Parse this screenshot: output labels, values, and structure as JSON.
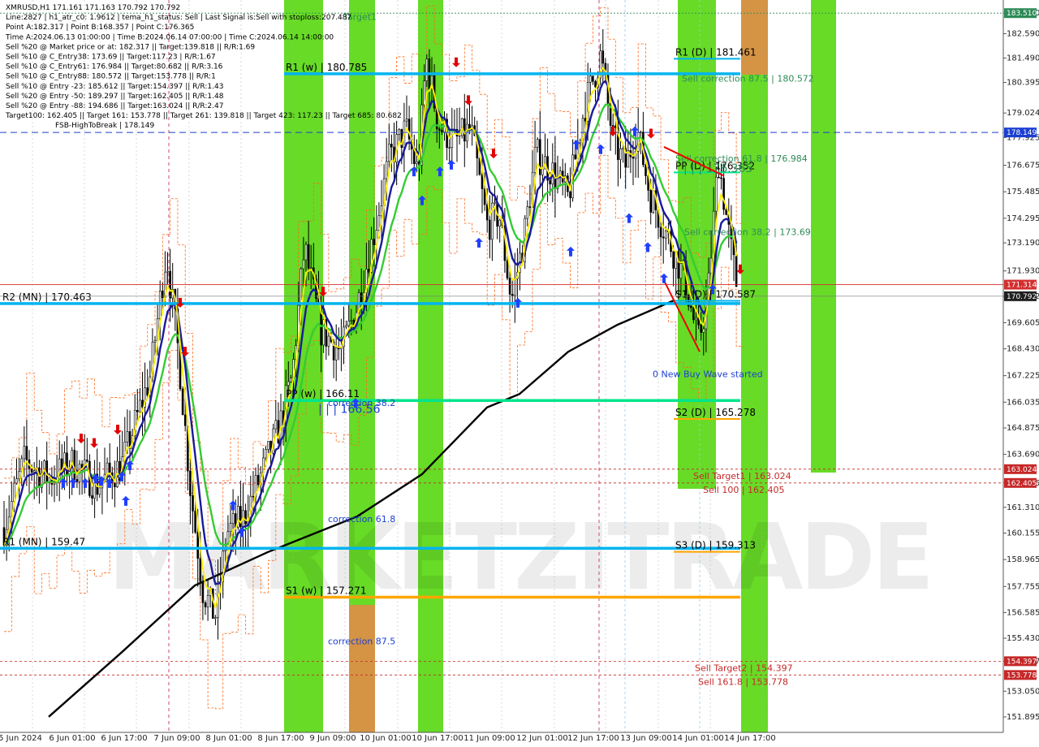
{
  "chart_data": {
    "type": "candlestick",
    "symbol": "XMRUSD,H1",
    "ylim": [
      151.2,
      184.1
    ],
    "x_ticks": [
      "5 Jun 2024",
      "6 Jun 01:00",
      "6 Jun 17:00",
      "7 Jun 09:00",
      "8 Jun 01:00",
      "8 Jun 17:00",
      "9 Jun 09:00",
      "10 Jun 01:00",
      "10 Jun 17:00",
      "11 Jun 09:00",
      "12 Jun 01:00",
      "12 Jun 17:00",
      "13 Jun 09:00",
      "14 Jun 01:00",
      "14 Jun 17:00"
    ],
    "y_ticks": [
      "183.510",
      "182.590",
      "181.490",
      "180.395",
      "179.024",
      "177.925",
      "176.675",
      "175.485",
      "174.295",
      "173.190",
      "171.930",
      "170.792",
      "169.605",
      "168.430",
      "167.225",
      "166.035",
      "164.875",
      "163.690",
      "162.405",
      "161.310",
      "160.155",
      "158.965",
      "157.755",
      "156.585",
      "155.430",
      "154.397",
      "153.050",
      "151.895"
    ],
    "price_badges": [
      {
        "text": "183.510",
        "value": 183.51,
        "color": "#2e8b57"
      },
      {
        "text": "178.149",
        "value": 178.149,
        "color": "#1b3fd1"
      },
      {
        "text": "171.314",
        "value": 171.314,
        "color": "#d32f2f"
      },
      {
        "text": "170.792",
        "value": 170.792,
        "color": "#202020"
      },
      {
        "text": "163.024",
        "value": 163.024,
        "color": "#c62828"
      },
      {
        "text": "162.405",
        "value": 162.405,
        "color": "#c62828"
      },
      {
        "text": "154.397",
        "value": 154.397,
        "color": "#c62828"
      },
      {
        "text": "153.778",
        "value": 153.778,
        "color": "#c62828"
      }
    ],
    "header_lines": [
      "XMRUSD,H1  171.161 171.163 170.792 170.792",
      "Line:2827 | h1_atr_c0: 1.9612 | tema_h1_status: Sell | Last Signal is:Sell with stoploss:207.487",
      "Point A:182.317 | Point B:168.357 | Point C:176.365",
      "Time A:2024.06.13 01:00:00 | Time B:2024.06.14 07:00:00 | Time C:2024.06.14 14:00:00",
      "Sell %20 @ Market price or at: 182.317 || Target:139.818 || R/R:1.69",
      "Sell %10 @ C_Entry38: 173.69 || Target:117.23 | R/R:1.67",
      "Sell %10 @ C_Entry61: 176.984 || Target:80.682 || R/R:3.16",
      "Sell %10 @ C_Entry88: 180.572 || Target:153.778 || R/R:1",
      "Sell %10 @ Entry -23: 185.612 || Target:154.397 || R/R:1.43",
      "Sell %20 @ Entry -50: 189.297 || Target:162.405 || R/R:1.48",
      "Sell %20 @ Entry -88: 194.686 || Target:163.024 || R/R:2.47",
      "Target100: 162.405 || Target 161: 153.778 || Target 261: 139.818 || Target 423: 117.23 || Target 685: 80.682",
      "FSB-HighToBreak | 178.149"
    ],
    "levels": [
      {
        "label": "R1 (w) | 180.785",
        "value": 180.785,
        "color": "#00b4f0"
      },
      {
        "label": "R2 (MN) | 170.463",
        "value": 170.463,
        "color": "#00b4f0"
      },
      {
        "label": "PP (w) | 166.11",
        "value": 166.11,
        "color": "#00e58a"
      },
      {
        "label": "R1 (MN) | 159.47",
        "value": 159.47,
        "color": "#00b4f0"
      },
      {
        "label": "S1 (w) | 157.271",
        "value": 157.271,
        "color": "#ffa500"
      },
      {
        "label": "R1 (D) | 181.461",
        "value": 181.461,
        "color": "#00b4f0"
      },
      {
        "label": "PP (D) | 176.352",
        "value": 176.352,
        "color": "#00e58a"
      },
      {
        "label": "S1 (D) | 170.587",
        "value": 170.587,
        "color": "#00b4f0"
      },
      {
        "label": "S2 (D) | 165.278",
        "value": 165.278,
        "color": "#ffa500"
      },
      {
        "label": "S3 (D) | 159.313",
        "value": 159.313,
        "color": "#ffa500"
      }
    ],
    "annotations": [
      {
        "text": "Target1",
        "value": 183.2,
        "color": "#2e8b57"
      },
      {
        "text": "Sell correction 87.5 | 180.572",
        "value": 180.572,
        "color": "#2e8b57"
      },
      {
        "text": "| | | 176.365",
        "value": 176.365,
        "color": "#2e8b57"
      },
      {
        "text": "Sell correction 61.8 | 176.984",
        "value": 176.984,
        "color": "#2e8b57"
      },
      {
        "text": "Sell correction 38.2 | 173.69",
        "value": 173.69,
        "color": "#2e8b57"
      },
      {
        "text": "0 New Buy Wave started",
        "value": 167.3,
        "color": "#1b3fd1"
      },
      {
        "text": "correction 38.2",
        "value": 166.0,
        "color": "#1b3fd1"
      },
      {
        "text": "| | | 166.56",
        "value": 165.7,
        "color": "#1b3fd1"
      },
      {
        "text": "correction 61.8",
        "value": 160.8,
        "color": "#1b3fd1"
      },
      {
        "text": "correction 87.5",
        "value": 155.3,
        "color": "#1b3fd1"
      },
      {
        "text": "Sell Target1 | 163.024",
        "value": 163.024,
        "color": "#c62828"
      },
      {
        "text": "Sell 100 | 162.405",
        "value": 162.405,
        "color": "#c62828"
      },
      {
        "text": "Sell Target2 | 154.397",
        "value": 154.397,
        "color": "#c62828"
      },
      {
        "text": "Sell 161.8 | 153.778",
        "value": 153.778,
        "color": "#c62828"
      }
    ],
    "watermark": "MARKETZITRADE",
    "bars": "generated",
    "close": 170.792
  },
  "colors": {
    "green_zone": "#4cd500",
    "orange_zone": "#e8874a",
    "sma_long": "#000000",
    "ema_fast": "#ffee00",
    "ema_mid": "#1a1a9a",
    "ema_slow": "#33cc33",
    "envelope": "#ff6a1a"
  }
}
